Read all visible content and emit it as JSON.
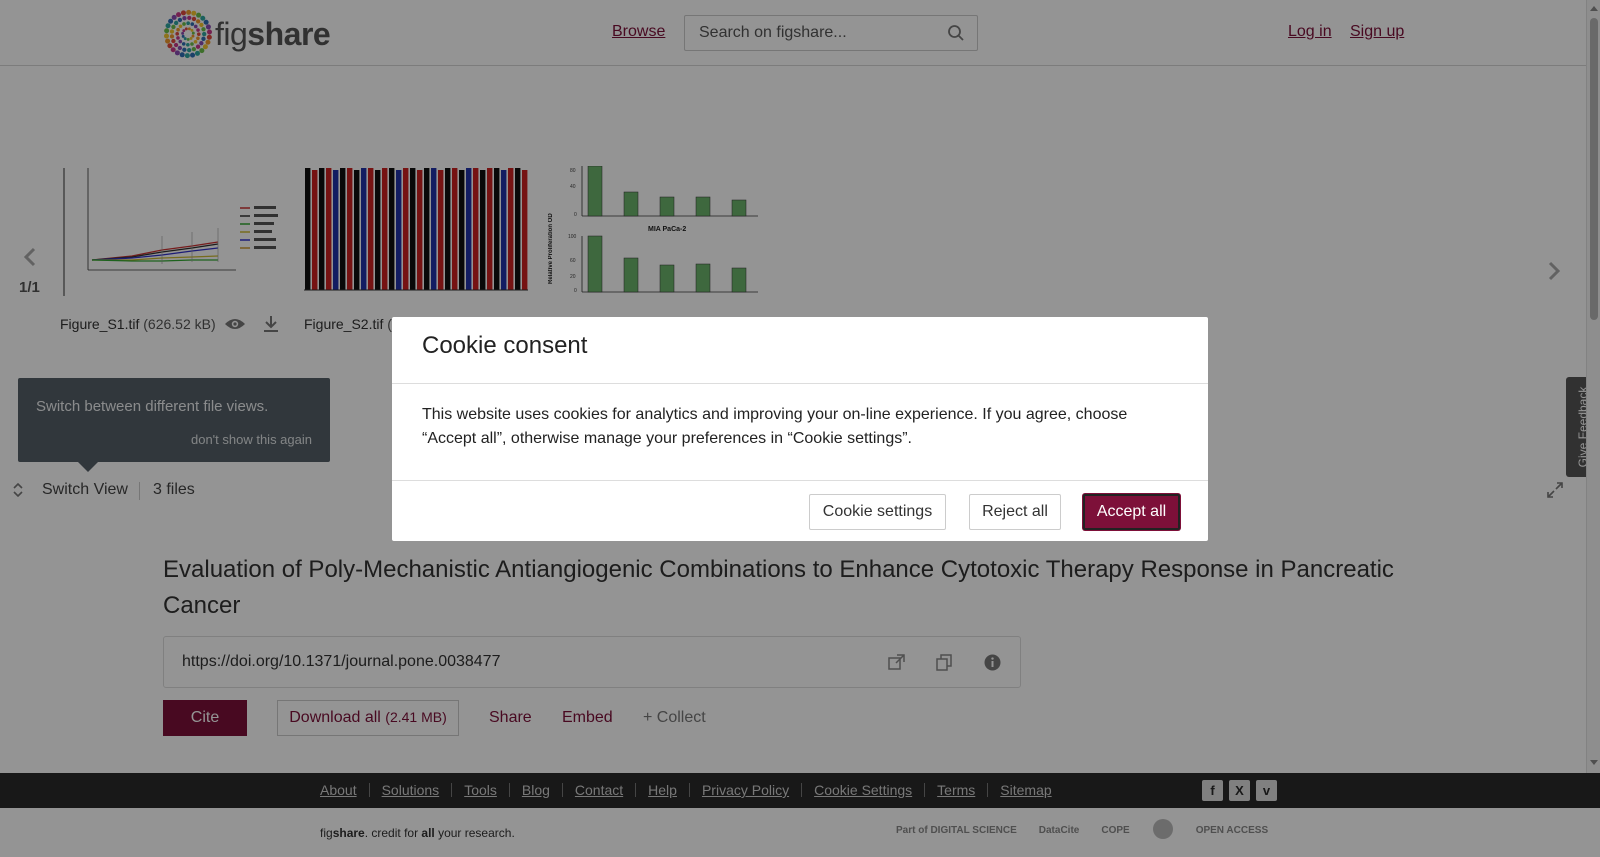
{
  "header": {
    "logo_text_light": "fig",
    "logo_text_bold": "share",
    "browse": "Browse",
    "search_placeholder": "Search on figshare...",
    "login": "Log in",
    "signup": "Sign up"
  },
  "viewer": {
    "counter": "1/1",
    "files": [
      {
        "name": "Figure_S1.tif",
        "size": "(626.52 kB)"
      },
      {
        "name": "Figure_S2.tif",
        "size": "("
      }
    ],
    "thumb3_label": "MIA PaCa-2",
    "thumb3_ylabel": "Relative Proliferation OD",
    "tooltip_text": "Switch between different file views.",
    "tooltip_dismiss": "don't show this again",
    "switch_view": "Switch View",
    "files_count": "3 files",
    "feedback": "Give Feedback"
  },
  "article": {
    "title": "Evaluation of Poly-Mechanistic Antiangiogenic Combinations to Enhance Cytotoxic Therapy Response in Pancreatic Cancer",
    "doi": "https://doi.org/10.1371/journal.pone.0038477",
    "cite": "Cite",
    "download_all": "Download all",
    "download_size": "(2.41 MB)",
    "share": "Share",
    "embed": "Embed",
    "collect": "+ Collect"
  },
  "cookie": {
    "title": "Cookie consent",
    "body": "This website uses cookies for analytics and improving your on-line experience. If you agree, choose “Accept all”, otherwise manage your preferences in “Cookie settings”.",
    "settings": "Cookie settings",
    "reject": "Reject all",
    "accept": "Accept all"
  },
  "footer": {
    "links": [
      "About",
      "Solutions",
      "Tools",
      "Blog",
      "Contact",
      "Help",
      "Privacy Policy",
      "Cookie Settings",
      "Terms",
      "Sitemap"
    ],
    "credit_light": "fig",
    "credit_bold": "share",
    "credit_mid": ". credit for ",
    "credit_all": "all",
    "credit_end": " your research.",
    "partners": [
      "Part of DIGITAL SCIENCE",
      "DataCite",
      "COPE",
      "",
      "OPEN ACCESS"
    ]
  },
  "colors": {
    "brand": "#7d1039",
    "overlay": "rgba(0,0,0,0.42)",
    "footer_dark": "#2a2a2a"
  }
}
